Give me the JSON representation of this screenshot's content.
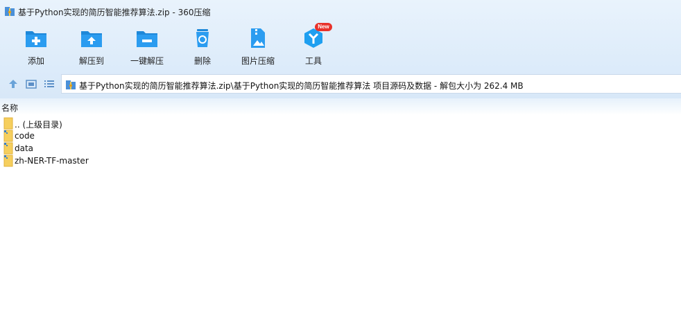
{
  "window": {
    "title": "基于Python实现的简历智能推荐算法.zip - 360压缩"
  },
  "toolbar": {
    "add": "添加",
    "extract_to": "解压到",
    "one_click_extract": "一键解压",
    "delete": "删除",
    "image_compress": "图片压缩",
    "tools": "工具",
    "new_badge": "New"
  },
  "nav": {
    "path": "基于Python实现的简历智能推荐算法.zip\\基于Python实现的简历智能推荐算法 项目源码及数据 - 解包大小为 262.4 MB"
  },
  "list": {
    "header_name": "名称",
    "items": [
      {
        "name": ".. (上级目录)",
        "icon": "folder-icon"
      },
      {
        "name": "code",
        "icon": "zip-folder-icon"
      },
      {
        "name": "data",
        "icon": "zip-folder-icon"
      },
      {
        "name": "zh-NER-TF-master",
        "icon": "zip-folder-icon"
      }
    ]
  },
  "colors": {
    "accent": "#1e88d9",
    "band": "#dcebfa",
    "badge": "#e8322b",
    "folder": "#f6cf5e"
  }
}
